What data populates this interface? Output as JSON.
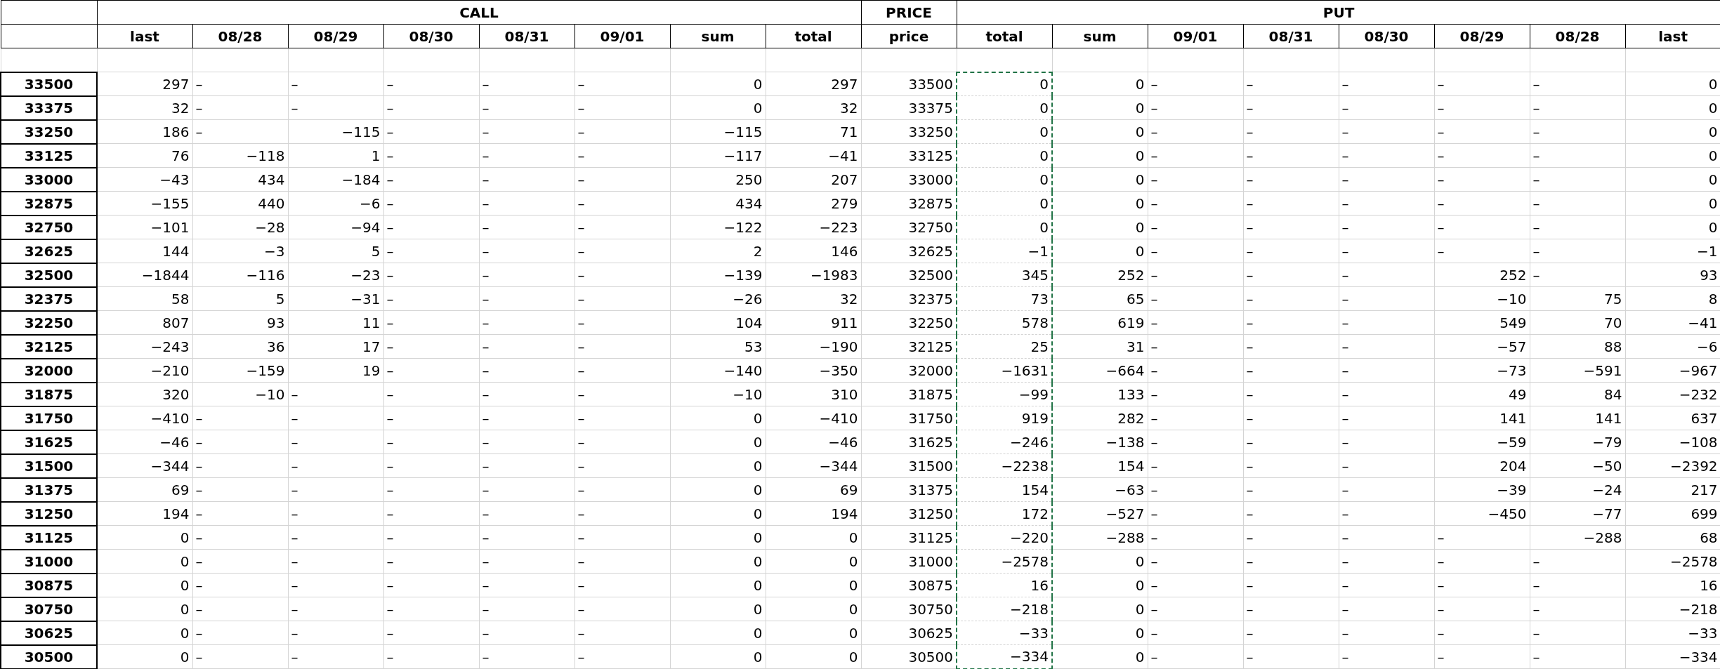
{
  "sheet": {
    "groups": [
      {
        "label": "CALL",
        "columns": [
          {
            "label": "last",
            "copied": false
          },
          {
            "label": "08/28",
            "copied": false
          },
          {
            "label": "08/29",
            "copied": false
          },
          {
            "label": "08/30",
            "copied": false
          },
          {
            "label": "08/31",
            "copied": false
          },
          {
            "label": "09/01",
            "copied": false
          },
          {
            "label": "sum",
            "copied": false
          },
          {
            "label": "total",
            "copied": false
          }
        ]
      },
      {
        "label": "PRICE",
        "columns": [
          {
            "label": "price",
            "copied": false
          }
        ]
      },
      {
        "label": "PUT",
        "columns": [
          {
            "label": "total",
            "copied": true
          },
          {
            "label": "sum",
            "copied": false
          },
          {
            "label": "09/01",
            "copied": false
          },
          {
            "label": "08/31",
            "copied": false
          },
          {
            "label": "08/30",
            "copied": false
          },
          {
            "label": "08/29",
            "copied": false
          },
          {
            "label": "08/28",
            "copied": false
          },
          {
            "label": "last",
            "copied": false
          }
        ]
      }
    ],
    "rows": [
      {
        "header": "33500",
        "cells": [
          "297",
          "–",
          "–",
          "–",
          "–",
          "–",
          "0",
          "297",
          "33500",
          "0",
          "0",
          "–",
          "–",
          "–",
          "–",
          "–",
          "0"
        ]
      },
      {
        "header": "33375",
        "cells": [
          "32",
          "–",
          "–",
          "–",
          "–",
          "–",
          "0",
          "32",
          "33375",
          "0",
          "0",
          "–",
          "–",
          "–",
          "–",
          "–",
          "0"
        ]
      },
      {
        "header": "33250",
        "cells": [
          "186",
          "–",
          "−115",
          "–",
          "–",
          "–",
          "−115",
          "71",
          "33250",
          "0",
          "0",
          "–",
          "–",
          "–",
          "–",
          "–",
          "0"
        ]
      },
      {
        "header": "33125",
        "cells": [
          "76",
          "−118",
          "1",
          "–",
          "–",
          "–",
          "−117",
          "−41",
          "33125",
          "0",
          "0",
          "–",
          "–",
          "–",
          "–",
          "–",
          "0"
        ]
      },
      {
        "header": "33000",
        "cells": [
          "−43",
          "434",
          "−184",
          "–",
          "–",
          "–",
          "250",
          "207",
          "33000",
          "0",
          "0",
          "–",
          "–",
          "–",
          "–",
          "–",
          "0"
        ]
      },
      {
        "header": "32875",
        "cells": [
          "−155",
          "440",
          "−6",
          "–",
          "–",
          "–",
          "434",
          "279",
          "32875",
          "0",
          "0",
          "–",
          "–",
          "–",
          "–",
          "–",
          "0"
        ]
      },
      {
        "header": "32750",
        "cells": [
          "−101",
          "−28",
          "−94",
          "–",
          "–",
          "–",
          "−122",
          "−223",
          "32750",
          "0",
          "0",
          "–",
          "–",
          "–",
          "–",
          "–",
          "0"
        ]
      },
      {
        "header": "32625",
        "cells": [
          "144",
          "−3",
          "5",
          "–",
          "–",
          "–",
          "2",
          "146",
          "32625",
          "−1",
          "0",
          "–",
          "–",
          "–",
          "–",
          "–",
          "−1"
        ]
      },
      {
        "header": "32500",
        "cells": [
          "−1844",
          "−116",
          "−23",
          "–",
          "–",
          "–",
          "−139",
          "−1983",
          "32500",
          "345",
          "252",
          "–",
          "–",
          "–",
          "252",
          "–",
          "93"
        ]
      },
      {
        "header": "32375",
        "cells": [
          "58",
          "5",
          "−31",
          "–",
          "–",
          "–",
          "−26",
          "32",
          "32375",
          "73",
          "65",
          "–",
          "–",
          "–",
          "−10",
          "75",
          "8"
        ]
      },
      {
        "header": "32250",
        "cells": [
          "807",
          "93",
          "11",
          "–",
          "–",
          "–",
          "104",
          "911",
          "32250",
          "578",
          "619",
          "–",
          "–",
          "–",
          "549",
          "70",
          "−41"
        ]
      },
      {
        "header": "32125",
        "cells": [
          "−243",
          "36",
          "17",
          "–",
          "–",
          "–",
          "53",
          "−190",
          "32125",
          "25",
          "31",
          "–",
          "–",
          "–",
          "−57",
          "88",
          "−6"
        ]
      },
      {
        "header": "32000",
        "cells": [
          "−210",
          "−159",
          "19",
          "–",
          "–",
          "–",
          "−140",
          "−350",
          "32000",
          "−1631",
          "−664",
          "–",
          "–",
          "–",
          "−73",
          "−591",
          "−967"
        ]
      },
      {
        "header": "31875",
        "cells": [
          "320",
          "−10",
          "–",
          "–",
          "–",
          "–",
          "−10",
          "310",
          "31875",
          "−99",
          "133",
          "–",
          "–",
          "–",
          "49",
          "84",
          "−232"
        ]
      },
      {
        "header": "31750",
        "cells": [
          "−410",
          "–",
          "–",
          "–",
          "–",
          "–",
          "0",
          "−410",
          "31750",
          "919",
          "282",
          "–",
          "–",
          "–",
          "141",
          "141",
          "637"
        ]
      },
      {
        "header": "31625",
        "cells": [
          "−46",
          "–",
          "–",
          "–",
          "–",
          "–",
          "0",
          "−46",
          "31625",
          "−246",
          "−138",
          "–",
          "–",
          "–",
          "−59",
          "−79",
          "−108"
        ]
      },
      {
        "header": "31500",
        "cells": [
          "−344",
          "–",
          "–",
          "–",
          "–",
          "–",
          "0",
          "−344",
          "31500",
          "−2238",
          "154",
          "–",
          "–",
          "–",
          "204",
          "−50",
          "−2392"
        ]
      },
      {
        "header": "31375",
        "cells": [
          "69",
          "–",
          "–",
          "–",
          "–",
          "–",
          "0",
          "69",
          "31375",
          "154",
          "−63",
          "–",
          "–",
          "–",
          "−39",
          "−24",
          "217"
        ]
      },
      {
        "header": "31250",
        "cells": [
          "194",
          "–",
          "–",
          "–",
          "–",
          "–",
          "0",
          "194",
          "31250",
          "172",
          "−527",
          "–",
          "–",
          "–",
          "−450",
          "−77",
          "699"
        ]
      },
      {
        "header": "31125",
        "cells": [
          "0",
          "–",
          "–",
          "–",
          "–",
          "–",
          "0",
          "0",
          "31125",
          "−220",
          "−288",
          "–",
          "–",
          "–",
          "–",
          "−288",
          "68"
        ]
      },
      {
        "header": "31000",
        "cells": [
          "0",
          "–",
          "–",
          "–",
          "–",
          "–",
          "0",
          "0",
          "31000",
          "−2578",
          "0",
          "–",
          "–",
          "–",
          "–",
          "–",
          "−2578"
        ]
      },
      {
        "header": "30875",
        "cells": [
          "0",
          "–",
          "–",
          "–",
          "–",
          "–",
          "0",
          "0",
          "30875",
          "16",
          "0",
          "–",
          "–",
          "–",
          "–",
          "–",
          "16"
        ]
      },
      {
        "header": "30750",
        "cells": [
          "0",
          "–",
          "–",
          "–",
          "–",
          "–",
          "0",
          "0",
          "30750",
          "−218",
          "0",
          "–",
          "–",
          "–",
          "–",
          "–",
          "−218"
        ]
      },
      {
        "header": "30625",
        "cells": [
          "0",
          "–",
          "–",
          "–",
          "–",
          "–",
          "0",
          "0",
          "30625",
          "−33",
          "0",
          "–",
          "–",
          "–",
          "–",
          "–",
          "−33"
        ]
      },
      {
        "header": "30500",
        "cells": [
          "0",
          "–",
          "–",
          "–",
          "–",
          "–",
          "0",
          "0",
          "30500",
          "−334",
          "0",
          "–",
          "–",
          "–",
          "–",
          "–",
          "−334"
        ]
      }
    ]
  }
}
